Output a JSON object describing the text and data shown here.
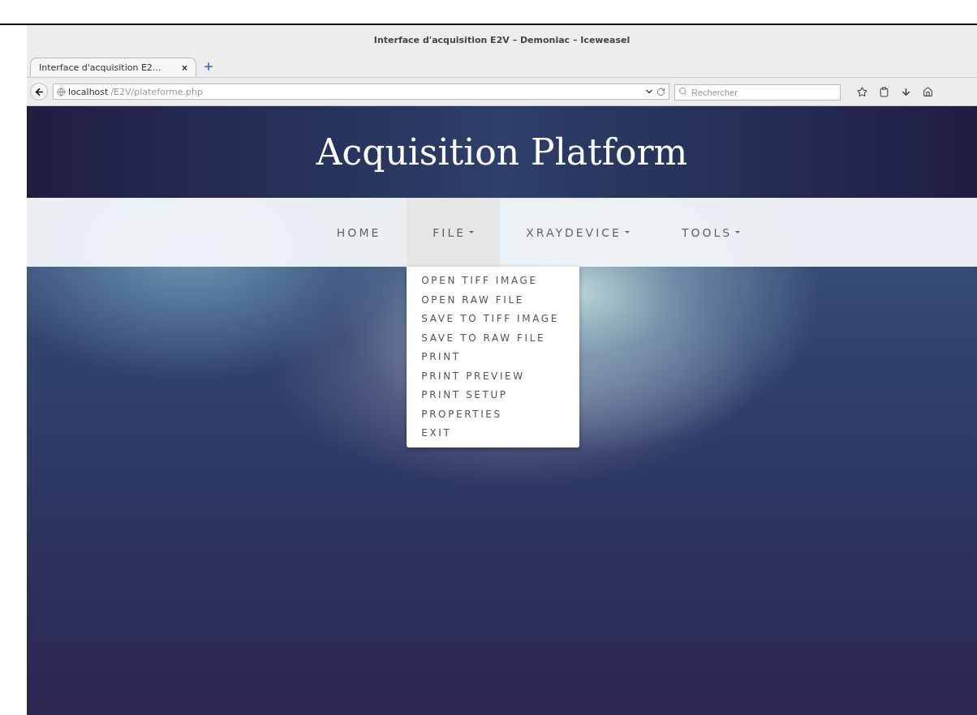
{
  "window": {
    "title": "Interface d'acquisition E2V – Demoniac – Iceweasel"
  },
  "tabs": [
    {
      "label": "Interface d'acquisition E2...",
      "selected": true,
      "close": "×"
    }
  ],
  "address_bar": {
    "host": "localhost",
    "path": "/E2V/plateforme.php"
  },
  "search": {
    "placeholder": "Rechercher"
  },
  "page": {
    "heading": "Acquisition Platform",
    "nav": [
      {
        "label": "HOME",
        "selected": false,
        "dropdown": false
      },
      {
        "label": "FILE",
        "selected": true,
        "dropdown": true
      },
      {
        "label": "XRAYDEVICE",
        "selected": false,
        "dropdown": true
      },
      {
        "label": "TOOLS",
        "selected": false,
        "dropdown": true
      }
    ],
    "file_menu": [
      "OPEN TIFF IMAGE",
      "OPEN RAW FILE",
      "SAVE TO TIFF IMAGE",
      "SAVE TO RAW FILE",
      "PRINT",
      "PRINT PREVIEW",
      "PRINT SETUP",
      "PROPERTIES",
      "EXIT"
    ]
  }
}
